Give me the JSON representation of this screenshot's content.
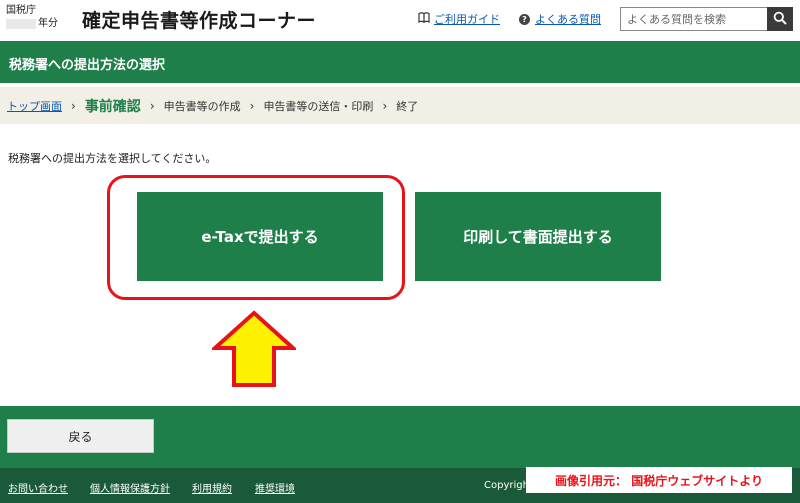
{
  "header": {
    "agency": "国税庁",
    "year_suffix": "年分",
    "title": "確定申告書等作成コーナー",
    "guide_link": "ご利用ガイド",
    "faq_link": "よくある質問",
    "search_placeholder": "よくある質問を検索"
  },
  "page_title": "税務署への提出方法の選択",
  "breadcrumb": {
    "top": "トップ画面",
    "current": "事前確認",
    "step3": "申告書等の作成",
    "step4": "申告書等の送信・印刷",
    "step5": "終了"
  },
  "instruction": "税務署への提出方法を選択してください。",
  "choices": {
    "etax": "e-Taxで提出する",
    "print": "印刷して書面提出する"
  },
  "back_label": "戻る",
  "footer": {
    "links": [
      "お問い合わせ",
      "個人情報保護方針",
      "利用規約",
      "推奨環境"
    ],
    "copyright": "Copyright",
    "credit": "画像引用元： 国税庁ウェブサイトより"
  },
  "colors": {
    "primary_green": "#1e7f4b",
    "footer_green": "#1a5a38",
    "highlight_red": "#e8131a",
    "arrow_yellow": "#fff200",
    "link_blue": "#0b58b3"
  },
  "icons": [
    "book-icon",
    "question-icon",
    "search-icon",
    "up-arrow-icon",
    "chevron-right-icon"
  ]
}
